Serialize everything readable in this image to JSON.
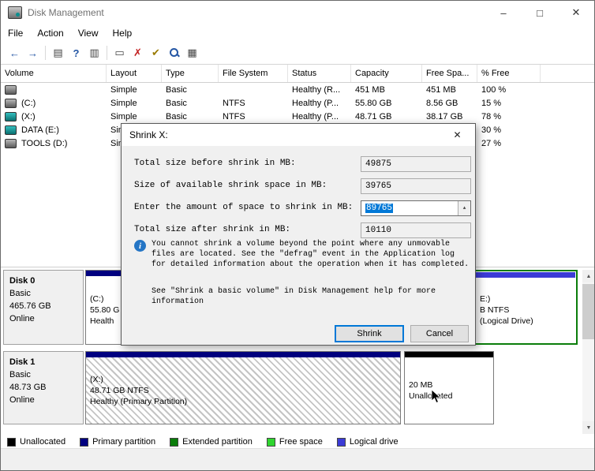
{
  "window": {
    "title": "Disk Management",
    "controls": {
      "minimize": "–",
      "maximize": "□",
      "close": "✕"
    }
  },
  "menu": {
    "items": [
      "File",
      "Action",
      "View",
      "Help"
    ]
  },
  "toolbar": {
    "icons": [
      {
        "name": "back",
        "glyph": "←"
      },
      {
        "name": "forward",
        "glyph": "→"
      },
      {
        "name": "show-console-tree",
        "glyph": "▤"
      },
      {
        "name": "help",
        "glyph": "?"
      },
      {
        "name": "export-list",
        "glyph": "▥"
      },
      {
        "name": "action-pane",
        "glyph": "▭"
      },
      {
        "name": "delete-volume",
        "glyph": "✗"
      },
      {
        "name": "ok",
        "glyph": "✔"
      },
      {
        "name": "find",
        "glyph": ""
      },
      {
        "name": "properties",
        "glyph": "▦"
      }
    ]
  },
  "icons": {
    "up": "▲",
    "down": "▼"
  },
  "table": {
    "columns": [
      "Volume",
      "Layout",
      "Type",
      "File System",
      "Status",
      "Capacity",
      "Free Spa...",
      "% Free"
    ],
    "rows": [
      {
        "volume": "",
        "layout": "Simple",
        "type": "Basic",
        "fs": "",
        "status": "Healthy (R...",
        "capacity": "451 MB",
        "free": "451 MB",
        "pct": "100 %"
      },
      {
        "volume": "(C:)",
        "layout": "Simple",
        "type": "Basic",
        "fs": "NTFS",
        "status": "Healthy (P...",
        "capacity": "55.80 GB",
        "free": "8.56 GB",
        "pct": "15 %"
      },
      {
        "volume": "(X:)",
        "layout": "Simple",
        "type": "Basic",
        "fs": "NTFS",
        "status": "Healthy (P...",
        "capacity": "48.71 GB",
        "free": "38.17 GB",
        "pct": "78 %"
      },
      {
        "volume": "DATA (E:)",
        "layout": "Simple",
        "type": "",
        "fs": "",
        "status": "",
        "capacity": "",
        "free": "",
        "pct": "30 %"
      },
      {
        "volume": "TOOLS (D:)",
        "layout": "Simple",
        "type": "",
        "fs": "",
        "status": "",
        "capacity": "",
        "free": "",
        "pct": "27 %"
      }
    ]
  },
  "dialog": {
    "title": "Shrink X:",
    "close": "✕",
    "fields": [
      {
        "label": "Total size before shrink in MB:",
        "value": "49875"
      },
      {
        "label": "Size of available shrink space in MB:",
        "value": "39765"
      },
      {
        "label": "Enter the amount of space to shrink in MB:",
        "value": "89765"
      },
      {
        "label": "Total size after shrink in MB:",
        "value": "10110"
      }
    ],
    "info_text": "You cannot shrink a volume beyond the point where any unmovable files are located. See the \"defrag\" event in the Application log for detailed information about the operation when it has completed.",
    "help_text": "See \"Shrink a basic volume\" in Disk Management help for more information",
    "buttons": {
      "shrink": "Shrink",
      "cancel": "Cancel"
    }
  },
  "disks": [
    {
      "name": "Disk 0",
      "kind": "Basic",
      "size": "465.76 GB",
      "status": "Online",
      "partitions": [
        {
          "line1": "(C:)",
          "line2": "55.80 G",
          "line3": "Health"
        },
        {
          "line1": "E:)",
          "line2": "B NTFS",
          "line3": "(Logical Drive)"
        }
      ]
    },
    {
      "name": "Disk 1",
      "kind": "Basic",
      "size": "48.73 GB",
      "status": "Online",
      "partitions": [
        {
          "line1": "(X:)",
          "line2": "48.71 GB NTFS",
          "line3": "Healthy (Primary Partition)"
        },
        {
          "line1": "20 MB",
          "line2": "Unallocated",
          "line3": ""
        }
      ]
    }
  ],
  "legend": {
    "items": [
      {
        "label": "Unallocated",
        "color": "#000000"
      },
      {
        "label": "Primary partition",
        "color": "#000080"
      },
      {
        "label": "Extended partition",
        "color": "#0a7d0a"
      },
      {
        "label": "Free space",
        "color": "#2fd52f"
      },
      {
        "label": "Logical drive",
        "color": "#3b3bd6"
      }
    ]
  },
  "colors": {
    "accent": "#0078d7",
    "selection": "#0078d7",
    "title_text": "#707070",
    "drive_icon_teal": "#0d8f8f"
  }
}
